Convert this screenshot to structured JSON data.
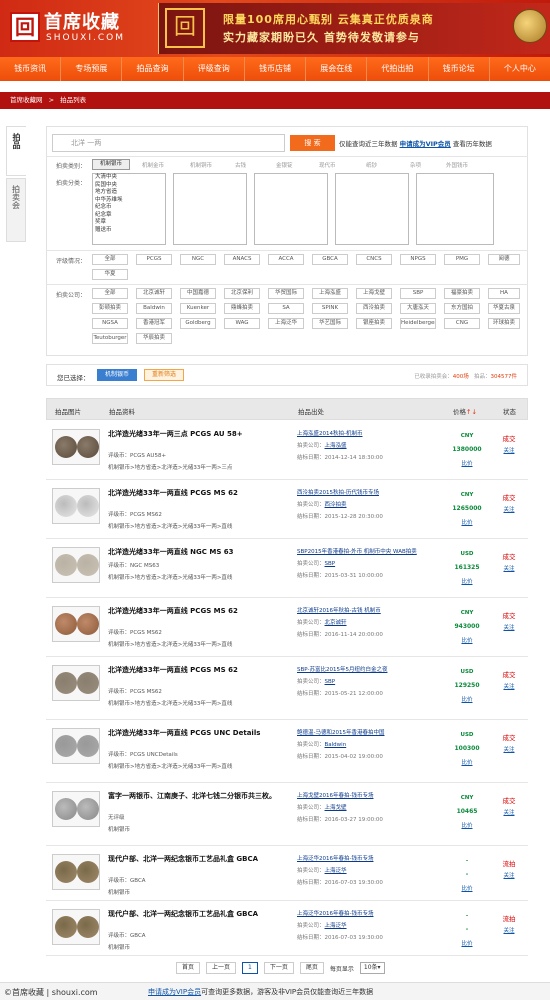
{
  "header": {
    "logo_mark": "回",
    "logo_cn": "首席收藏",
    "logo_en": "SHOUXI.COM",
    "ad_mark": "回",
    "ad_line1": "限量100席用心甄别 云集真正优质泉商",
    "ad_line2": "实力藏家期盼已久 首势待发敬请参与"
  },
  "nav": [
    "钱币资讯",
    "专场预展",
    "拍品查询",
    "评级查询",
    "钱币店铺",
    "展会在线",
    "代拍出拍",
    "钱币论坛",
    "个人中心"
  ],
  "breadcrumb": [
    "首席收藏网",
    ">",
    "拍品列表"
  ],
  "side_tabs": {
    "active": "拍品",
    "inactive": "拍卖会"
  },
  "search": {
    "placeholder": "北洋 一两",
    "button": "搜 索",
    "hint_prefix": "仅能查询近三年数据",
    "hint_link": "申请成为VIP会员",
    "hint_suffix": "查看历年数据"
  },
  "filters": {
    "category_label": "拍卖类别：",
    "categories": [
      {
        "label": "机制银币",
        "selected": true
      },
      {
        "label": "机制金币",
        "selected": false
      },
      {
        "label": "机制铜币",
        "selected": false
      },
      {
        "label": "古钱",
        "selected": false
      },
      {
        "label": "金银锭",
        "selected": false
      },
      {
        "label": "现代币",
        "selected": false
      },
      {
        "label": "纸钞",
        "selected": false
      },
      {
        "label": "杂项",
        "selected": false
      },
      {
        "label": "外国钱币",
        "selected": false
      }
    ],
    "class_label": "拍卖分类：",
    "class_list": [
      "大清中央",
      "民国中央",
      "地方省造",
      "中华苏维埃",
      "纪念币",
      "纪念章",
      "奖章",
      "赠送币"
    ],
    "grade_label": "评级情况：",
    "grades": [
      "全部",
      "PCGS",
      "NGC",
      "ANACS",
      "ACCA",
      "GBCA",
      "CNCS",
      "NPGS",
      "PMG",
      "阅德",
      "华夏"
    ],
    "company_label": "拍卖公司：",
    "companies": [
      "全部",
      "北京诚轩",
      "中国嘉德",
      "北京保利",
      "华贸国际",
      "上海泓盛",
      "上海戈壁",
      "SBP",
      "福豪拍卖",
      "HA",
      "彭顿拍卖",
      "Baldwin",
      "Kuenker",
      "鼎峰拍卖",
      "SA",
      "SPINK",
      "西泠拍卖",
      "大唐泓天",
      "东方国拍",
      "华夏古泉",
      "NGSA",
      "香港冠军",
      "Goldberg",
      "WAG",
      "上海泛华",
      "华艺国际",
      "银座拍卖",
      "Heidelberger",
      "CNG",
      "环球拍卖",
      "Teutoburger",
      "华辰拍卖"
    ]
  },
  "selected": {
    "label": "您已选择：",
    "tag": "机制银币",
    "reset": "重新筛选",
    "count_prefix": "已收录拍卖会：",
    "sessions": "400场",
    "lots_prefix": "拍品：",
    "lots": "304577件"
  },
  "table_head": {
    "col1": "拍品图片",
    "col2": "拍品资料",
    "col3": "拍品出处",
    "col4": "价格",
    "sort": "↑↓",
    "col5": "状态"
  },
  "rows": [
    {
      "title": "北洋造光绪33年一两三点 PCGS AU 58+",
      "grade": "评级币：PCGS AU58+",
      "path": "机制银币>地方省造>北洋造>光绪33年一两>三点",
      "source": "上海泓盛2014秋拍-机制币",
      "company": "上海泓盛",
      "date": "2014-12-14 18:30:00",
      "currency": "CNY",
      "price": "1380000",
      "compare": "比价",
      "status": "成交",
      "follow": "关注"
    },
    {
      "title": "北洋造光绪33年一两直线 PCGS MS 62",
      "grade": "评级币：PCGS MS62",
      "path": "机制银币>地方省造>北洋造>光绪33年一两>直线",
      "source": "西泠拍卖2015秋拍-历代钱币专场",
      "company": "西泠拍卖",
      "date": "2015-12-28 20:30:00",
      "currency": "CNY",
      "price": "1265000",
      "compare": "比价",
      "status": "成交",
      "follow": "关注"
    },
    {
      "title": "北洋造光绪33年一两直线 NGC MS 63",
      "grade": "评级币：NGC MS63",
      "path": "机制银币>地方省造>北洋造>光绪33年一两>直线",
      "source": "SBP2015年香港春拍-外币 机制币中央 WAB拍卖",
      "company": "SBP",
      "date": "2015-03-31 10:00:00",
      "currency": "USD",
      "price": "161325",
      "compare": "比价",
      "status": "成交",
      "follow": "关注"
    },
    {
      "title": "北洋造光绪33年一两直线 PCGS MS 62",
      "grade": "评级币：PCGS MS62",
      "path": "机制银币>地方省造>北洋造>光绪33年一两>直线",
      "source": "北京诚轩2016年秋拍-古钱 机制币",
      "company": "北京诚轩",
      "date": "2016-11-14 20:00:00",
      "currency": "CNY",
      "price": "943000",
      "compare": "比价",
      "status": "成交",
      "follow": "关注"
    },
    {
      "title": "北洋造光绪33年一两直线 PCGS MS 62",
      "grade": "评级币：PCGS MS62",
      "path": "机制银币>地方省造>北洋造>光绪33年一两>直线",
      "source": "SBP-苏富比2015年5月纽约白金之夜",
      "company": "SBP",
      "date": "2015-05-21 12:00:00",
      "currency": "USD",
      "price": "129250",
      "compare": "比价",
      "status": "成交",
      "follow": "关注"
    },
    {
      "title": "北洋造光绪33年一两直线 PCGS UNC Details",
      "grade": "评级币：PCGS UNCDetails",
      "path": "机制银币>地方省造>北洋造>光绪33年一两>直线",
      "source": "鲍德温-马德和2015年香港春拍中国",
      "company": "Baldwin",
      "date": "2015-04-02 19:00:00",
      "currency": "USD",
      "price": "100300",
      "compare": "比价",
      "status": "成交",
      "follow": "关注"
    },
    {
      "title": "富字一两银币、江南庚子、北洋七钱二分银币共三枚。",
      "grade": "无评级",
      "path": "机制银币",
      "source": "上海戈壁2016年春拍-钱币专场",
      "company": "上海戈壁",
      "date": "2016-03-27 19:00:00",
      "currency": "CNY",
      "price": "10465",
      "compare": "比价",
      "status": "成交",
      "follow": "关注"
    },
    {
      "title": "现代户部、北洋一两纪念银币工艺品礼盒 GBCA",
      "grade": "评级币：GBCA",
      "path": "机制银币",
      "source": "上海泛华2016年春拍-钱币专场",
      "company": "上海泛华",
      "date": "2016-07-03 19:30:00",
      "currency": "-",
      "price": "-",
      "compare": "比价",
      "status": "流拍",
      "follow": "关注"
    },
    {
      "title": "现代户部、北洋一两纪念银币工艺品礼盒 GBCA",
      "grade": "评级币：GBCA",
      "path": "机制银币",
      "source": "上海泛华2016年春拍-钱币专场",
      "company": "上海泛华",
      "date": "2016-07-03 19:30:00",
      "currency": "-",
      "price": "-",
      "compare": "比价",
      "status": "流拍",
      "follow": "关注"
    }
  ],
  "labels": {
    "company": "拍卖公司：",
    "date": "结标日期："
  },
  "pager": {
    "first": "首页",
    "prev": "上一页",
    "page": "1",
    "next": "下一页",
    "last": "尾页",
    "per_page_label": "每页显示",
    "per_page": "10条"
  },
  "footer": {
    "watermark": "©首席收藏 | shouxi.com",
    "link": "申请成为VIP会员",
    "text": "可查询更多数据，游客及非VIP会员仅能查询近三年数据"
  }
}
